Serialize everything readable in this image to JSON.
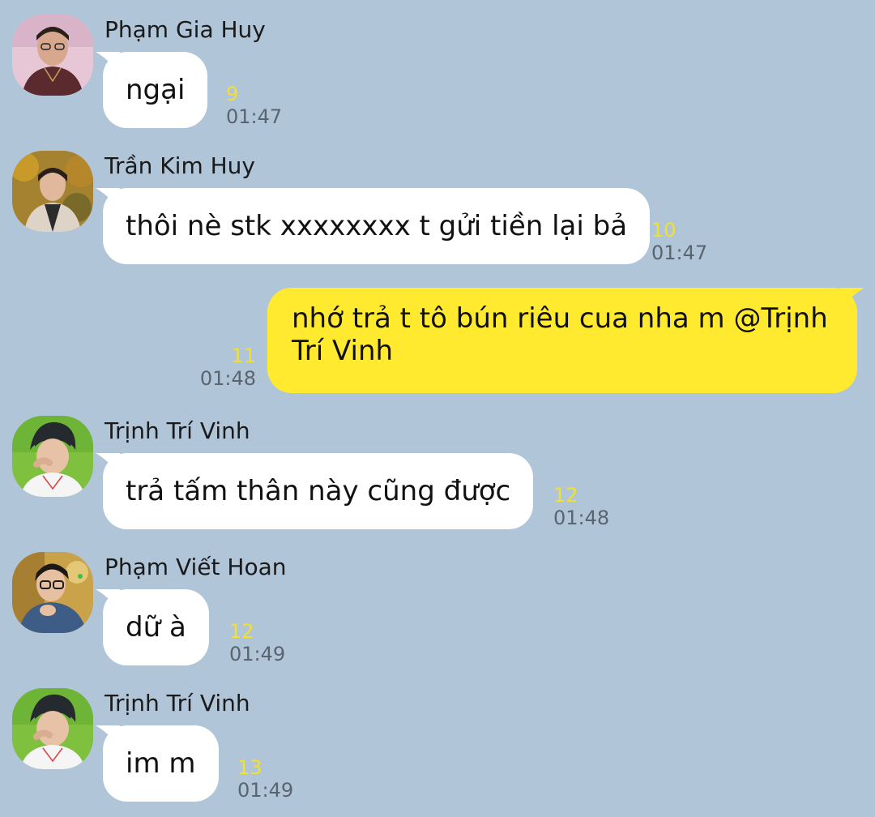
{
  "colors": {
    "background": "#b1c5d9",
    "incoming_bubble": "#ffffff",
    "outgoing_bubble": "#ffea30",
    "unread_count": "#f2df30",
    "timestamp": "#5a6470"
  },
  "messages": [
    {
      "sender": "Phạm Gia Huy",
      "text": "ngại",
      "unread": "9",
      "time": "01:47",
      "avatar": "pham-gia-huy-avatar"
    },
    {
      "sender": "Trần Kim Huy",
      "text": "thôi nè stk xxxxxxxx t gửi tiền lại bả",
      "unread": "10",
      "time": "01:47",
      "avatar": "tran-kim-huy-avatar"
    },
    {
      "outgoing": true,
      "text_line1": "nhớ trả t tô bún riêu cua nha m @Trịnh",
      "text_line2": "Trí Vinh",
      "unread": "11",
      "time": "01:48"
    },
    {
      "sender": "Trịnh Trí Vinh",
      "text": "trả tấm thân này cũng được",
      "unread": "12",
      "time": "01:48",
      "avatar": "trinh-tri-vinh-avatar"
    },
    {
      "sender": "Phạm Viết Hoan",
      "text": "dữ à",
      "unread": "12",
      "time": "01:49",
      "avatar": "pham-viet-hoan-avatar"
    },
    {
      "sender": "Trịnh Trí Vinh",
      "text": "im m",
      "unread": "13",
      "time": "01:49",
      "avatar": "trinh-tri-vinh-avatar"
    }
  ]
}
